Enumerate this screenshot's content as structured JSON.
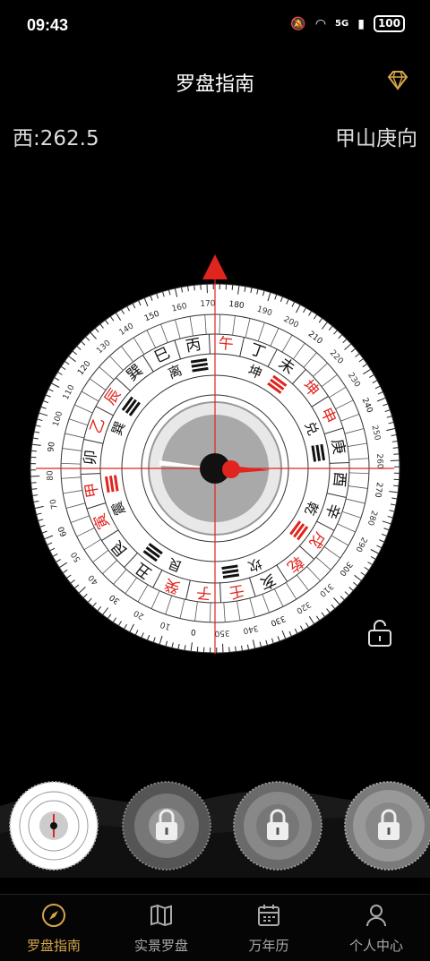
{
  "status_bar": {
    "time": "09:43",
    "network": "5G",
    "battery": "100"
  },
  "header": {
    "title": "罗盘指南"
  },
  "readout": {
    "direction": "西:262.5",
    "mountain": "甲山庚向"
  },
  "compass": {
    "heading_deg": 262.5,
    "degree_labels": [
      "0",
      "10",
      "20",
      "30",
      "40",
      "50",
      "60",
      "70",
      "80",
      "90",
      "100",
      "110",
      "120",
      "130",
      "140",
      "150",
      "160",
      "170",
      "180",
      "190",
      "200",
      "210",
      "220",
      "230",
      "240",
      "250",
      "260",
      "270",
      "280",
      "290",
      "300",
      "310",
      "320",
      "330",
      "340",
      "350"
    ],
    "mountains": [
      "庚",
      "酉",
      "辛",
      "戌",
      "乾",
      "亥",
      "壬",
      "子",
      "癸",
      "丑",
      "艮",
      "寅",
      "甲",
      "卯",
      "乙",
      "辰",
      "巽",
      "巳",
      "丙",
      "午",
      "丁",
      "未",
      "坤",
      "申"
    ],
    "mountain_red": [
      false,
      false,
      false,
      true,
      true,
      false,
      true,
      true,
      true,
      false,
      false,
      true,
      true,
      false,
      true,
      true,
      false,
      false,
      false,
      true,
      false,
      false,
      true,
      true
    ],
    "inner_ring": [
      "兑",
      "乾",
      "坎",
      "艮",
      "震",
      "巽",
      "离",
      "坤"
    ],
    "colors": {
      "accent_red": "#e0241e",
      "gold": "#d4a64a"
    }
  },
  "bottom_nav": {
    "items": [
      {
        "label": "罗盘指南"
      },
      {
        "label": "实景罗盘"
      },
      {
        "label": "万年历"
      },
      {
        "label": "个人中心"
      }
    ]
  }
}
